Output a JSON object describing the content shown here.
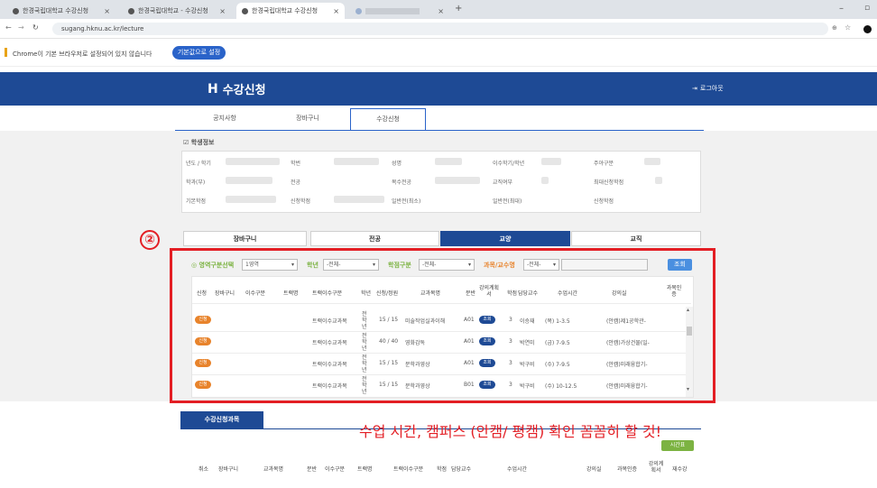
{
  "browser": {
    "tabs": [
      {
        "label": "한경국립대학교 수강신청"
      },
      {
        "label": "한경국립대학교 - 수강신청"
      },
      {
        "label": "한경국립대학교 수강신청"
      }
    ],
    "url": "sugang.hknu.ac.kr/lecture",
    "info_text": "Chrome이 기본 브라우저로 설정되어 있지 않습니다",
    "info_button": "기본값으로 설정"
  },
  "site": {
    "logo": "수강신청",
    "logout": "로그아웃"
  },
  "nav": {
    "tabs": [
      "공지사항",
      "장바구니",
      "수강신청"
    ]
  },
  "student": {
    "title": "학생정보",
    "labels": [
      "년도 / 학기",
      "학번",
      "성명",
      "이수학기/학년",
      "주야구분",
      "학과(부)",
      "전공",
      "복수전공",
      "교직여부",
      "최대신청학점",
      "기본학점",
      "신청학점",
      "일반전(최소)",
      "일반전(최대)",
      "신청학점"
    ]
  },
  "section_tabs": [
    "장바구니",
    "전공",
    "교양",
    "교직"
  ],
  "step_marker": "②",
  "filters": {
    "area_label": "영역구분선택",
    "area_value": "1영역",
    "grade_label": "학년",
    "grade_value": "-전체-",
    "type_label": "학점구분",
    "type_value": "-전체-",
    "course_label": "과목/교수명",
    "course_value": "-전체-",
    "search_button": "조회"
  },
  "table": {
    "headers": [
      "신청",
      "장바구니",
      "이수구분",
      "트랙명",
      "트랙이수구분",
      "학년",
      "신청/정원",
      "교과목명",
      "분반",
      "강의계획서",
      "학점",
      "담당교수",
      "수업시간",
      "강의실",
      "과목인증"
    ],
    "rows": [
      {
        "apply": "신청",
        "track_type": "트랙이수교과목",
        "grade": "전학년",
        "count": "15 / 15",
        "course": "미술작업실과이해",
        "section": "A01",
        "plan": "조회",
        "credit": "3",
        "prof": "이승재",
        "time": "(목) 1-3.5",
        "room": "(안캠)제1공학관-"
      },
      {
        "apply": "신청",
        "track_type": "트랙이수교과목",
        "grade": "전학년",
        "count": "40 / 40",
        "course": "영화감독",
        "section": "A01",
        "plan": "조회",
        "credit": "3",
        "prof": "박연미",
        "time": "(금) 7-9.5",
        "room": "(안캠)가상건물(일-"
      },
      {
        "apply": "신청",
        "track_type": "트랙이수교과목",
        "grade": "전학년",
        "count": "15 / 15",
        "course": "문학과영상",
        "section": "A01",
        "plan": "조회",
        "credit": "3",
        "prof": "박구비",
        "time": "(수) 7-9.5",
        "room": "(안캠)미래융합기-"
      },
      {
        "apply": "신청",
        "track_type": "트랙이수교과목",
        "grade": "전학년",
        "count": "15 / 15",
        "course": "문학과영상",
        "section": "B01",
        "plan": "조회",
        "credit": "3",
        "prof": "박구비",
        "time": "(수) 10-12.5",
        "room": "(안캠)미래융합기-"
      }
    ]
  },
  "registered": {
    "tab": "수강신청과목",
    "time_button": "시간표",
    "headers": [
      "취소",
      "장바구니",
      "교과목명",
      "분반",
      "이수구분",
      "트랙명",
      "트랙이수구분",
      "학점",
      "담당교수",
      "수업시간",
      "강의실",
      "과목인증",
      "강의계획서",
      "재수강"
    ]
  },
  "annotation": "수업 시간, 캠퍼스 (안캠/ 평캠) 확인 꼼꼼히 할 것!",
  "colors": {
    "header_blue": "#1e4a95",
    "highlight_red": "#e31e24",
    "apply_orange": "#e8832b",
    "filter_green": "#7cb342"
  }
}
